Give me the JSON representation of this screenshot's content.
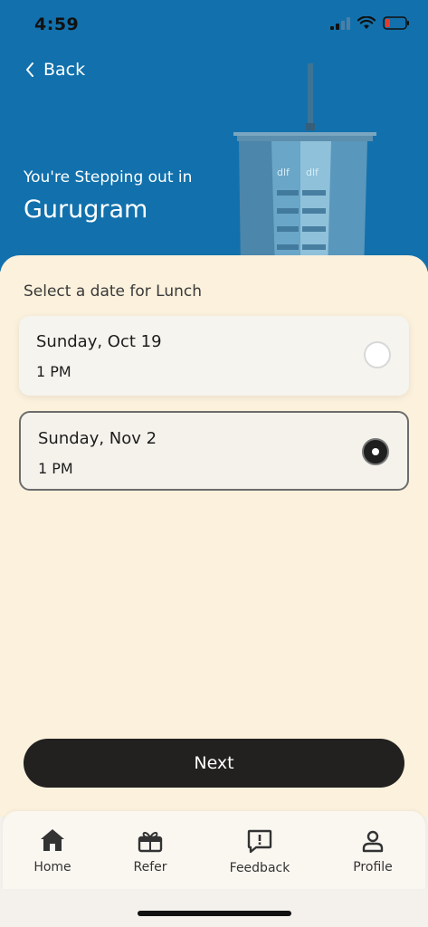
{
  "status": {
    "time": "4:59"
  },
  "header": {
    "back_label": "Back",
    "subtitle": "You're Stepping out in",
    "city": "Gurugram",
    "building_sign": "dlf"
  },
  "content": {
    "section_label": "Select a date for Lunch",
    "options": [
      {
        "date": "Sunday, Oct 19",
        "time": "1 PM",
        "selected": false
      },
      {
        "date": "Sunday, Nov 2",
        "time": "1 PM",
        "selected": true
      }
    ],
    "next_label": "Next"
  },
  "tabs": [
    {
      "label": "Home",
      "icon": "home-icon"
    },
    {
      "label": "Refer",
      "icon": "gift-icon"
    },
    {
      "label": "Feedback",
      "icon": "feedback-icon"
    },
    {
      "label": "Profile",
      "icon": "profile-icon"
    }
  ],
  "colors": {
    "header_blue": "#1271ac",
    "content_bg": "#fbf1dc",
    "button_dark": "#222120"
  }
}
